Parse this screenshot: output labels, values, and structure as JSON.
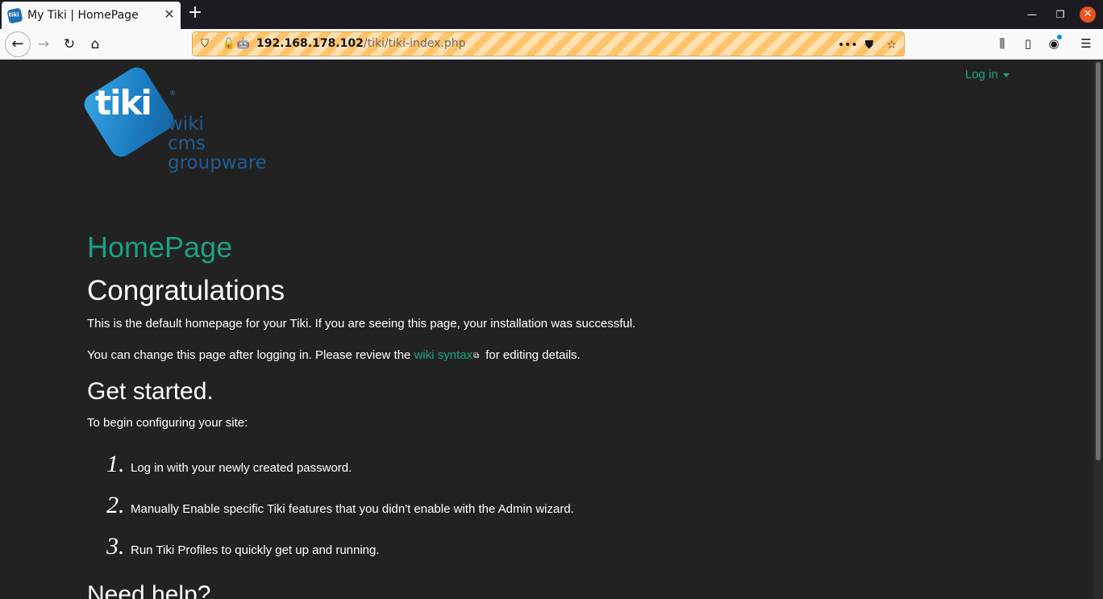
{
  "browser": {
    "tab_title": "My Tiki | HomePage",
    "tab_favicon_text": "tiki",
    "url_host": "192.168.178.102",
    "url_path": "/tiki/tiki-index.php"
  },
  "logo": {
    "word": "tiki",
    "lines": [
      "wiki",
      "cms",
      "groupware"
    ],
    "registered": "®"
  },
  "header": {
    "login_label": "Log in"
  },
  "page": {
    "title": "HomePage",
    "heading": "Congratulations",
    "intro": "This is the default homepage for your Tiki. If you are seeing this page, your installation was successful.",
    "change_before": "You can change this page after logging in. Please review the ",
    "change_link": "wiki syntax",
    "change_after": " for editing details.",
    "get_started_heading": "Get started.",
    "get_started_intro": "To begin configuring your site:",
    "steps": [
      {
        "num": "1.",
        "before": "Log in with your newly created password.",
        "link": "",
        "after": ""
      },
      {
        "num": "2.",
        "before": "Manually ",
        "link": "Enable specific Tiki features",
        "after": " that you didn't enable with the Admin wizard."
      },
      {
        "num": "3.",
        "before": "Run ",
        "link": "Tiki Profiles",
        "after": " to quickly get up and running."
      }
    ],
    "need_help_heading": "Need help?"
  },
  "colors": {
    "accent": "#17a284",
    "background": "#222222",
    "logo_blue": "#1d7fc4"
  }
}
